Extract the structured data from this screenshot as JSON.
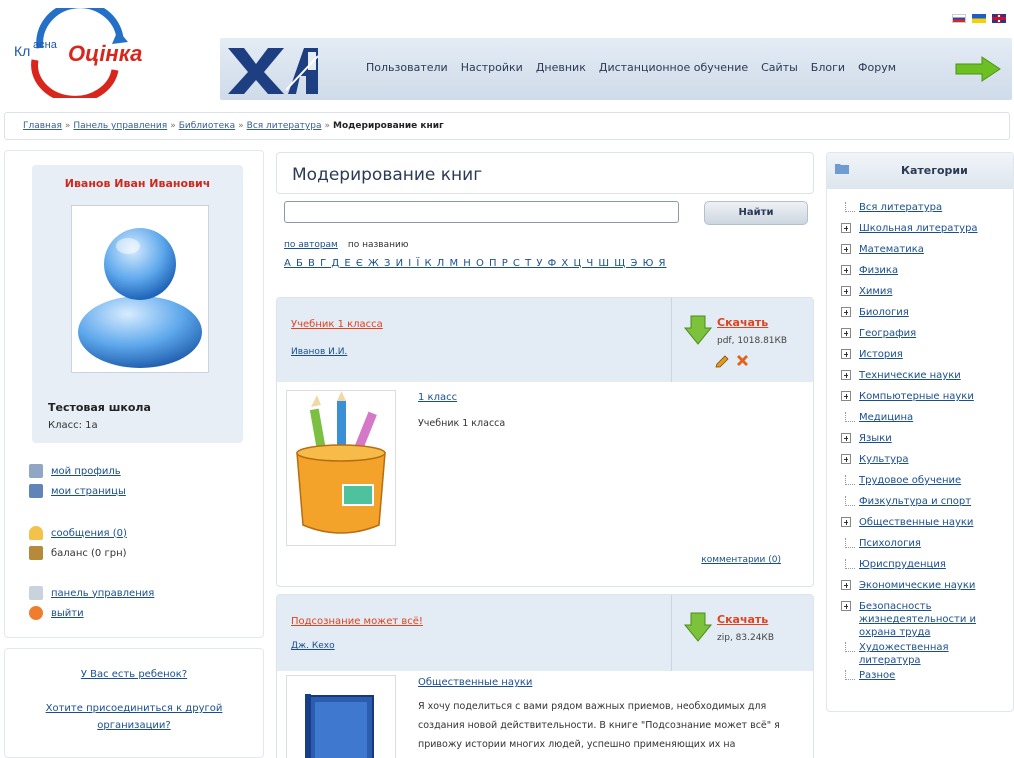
{
  "logo": {
    "part1": "Кл",
    "part2": "асна",
    "part3": "Оцінка"
  },
  "languages": [
    "ru",
    "ua",
    "en"
  ],
  "header": {
    "nav": [
      "Пользователи",
      "Настройки",
      "Дневник",
      "Дистанционное обучение",
      "Сайты",
      "Блоги",
      "Форум"
    ]
  },
  "breadcrumb": {
    "items": [
      "Главная",
      "Панель управления",
      "Библиотека",
      "Вся литература"
    ],
    "separator": "»",
    "current": "Модерирование книг"
  },
  "profile": {
    "name": "Иванов Иван Иванович",
    "school": "Тестовая школа",
    "class": "Класс: 1а"
  },
  "left_menu": {
    "my_profile": "мой профиль",
    "my_pages": "мои страницы",
    "messages": "сообщения (0)",
    "balance": "баланс (0 грн)",
    "control_panel": "панель управления",
    "logout": "выйти"
  },
  "left_box2": {
    "have_child": "У Вас есть ребенок?",
    "join_org": "Хотите присоединиться к другой организации?"
  },
  "main": {
    "title": "Модерирование книг",
    "search_button": "Найти",
    "search_value": "",
    "sort_by_author": "по авторам",
    "sort_by_name": "по названию",
    "alphabet": "А Б В Г Д Е Є Ж З И І Ї К Л М Н О П Р С Т У Ф Х Ц Ч Ш Щ Э Ю Я"
  },
  "books": [
    {
      "title": "Учебник 1 класса",
      "author": "Иванов И.И.",
      "download": "Скачать",
      "meta": "pdf, 1018.81КВ",
      "category": "1 класс",
      "description": "Учебник 1 класса",
      "comments": "комментарии (0)"
    },
    {
      "title": "Подсознание может всё!",
      "author": "Дж. Кехо",
      "download": "Скачать",
      "meta": "zip, 83.24КВ",
      "category": "Общественные науки",
      "description": "Я хочу поделиться с вами рядом важных приемов, необходимых для создания новой действительности. В книге \"Подсознание может всё\" я привожу истории многих людей, успешно применяющих их на"
    }
  ],
  "categories": {
    "title": "Категории",
    "items": [
      {
        "label": "Вся литература",
        "expandable": false
      },
      {
        "label": "Школьная литература",
        "expandable": true
      },
      {
        "label": "Математика",
        "expandable": true
      },
      {
        "label": "Физика",
        "expandable": true
      },
      {
        "label": "Химия",
        "expandable": true
      },
      {
        "label": "Биология",
        "expandable": true
      },
      {
        "label": "География",
        "expandable": true
      },
      {
        "label": "История",
        "expandable": true
      },
      {
        "label": "Технические науки",
        "expandable": true
      },
      {
        "label": "Компьютерные науки",
        "expandable": true
      },
      {
        "label": "Медицина",
        "expandable": false
      },
      {
        "label": "Языки",
        "expandable": true
      },
      {
        "label": "Культура",
        "expandable": true
      },
      {
        "label": "Трудовое обучение",
        "expandable": false
      },
      {
        "label": "Физкультура и спорт",
        "expandable": false
      },
      {
        "label": "Общественные науки",
        "expandable": true
      },
      {
        "label": "Психология",
        "expandable": false
      },
      {
        "label": "Юриспруденция",
        "expandable": false
      },
      {
        "label": "Экономические науки",
        "expandable": true
      },
      {
        "label": "Безопасность жизнедеятельности и охрана труда",
        "expandable": true
      },
      {
        "label": "Художественная литература",
        "expandable": false
      },
      {
        "label": "Разное",
        "expandable": false
      }
    ]
  }
}
